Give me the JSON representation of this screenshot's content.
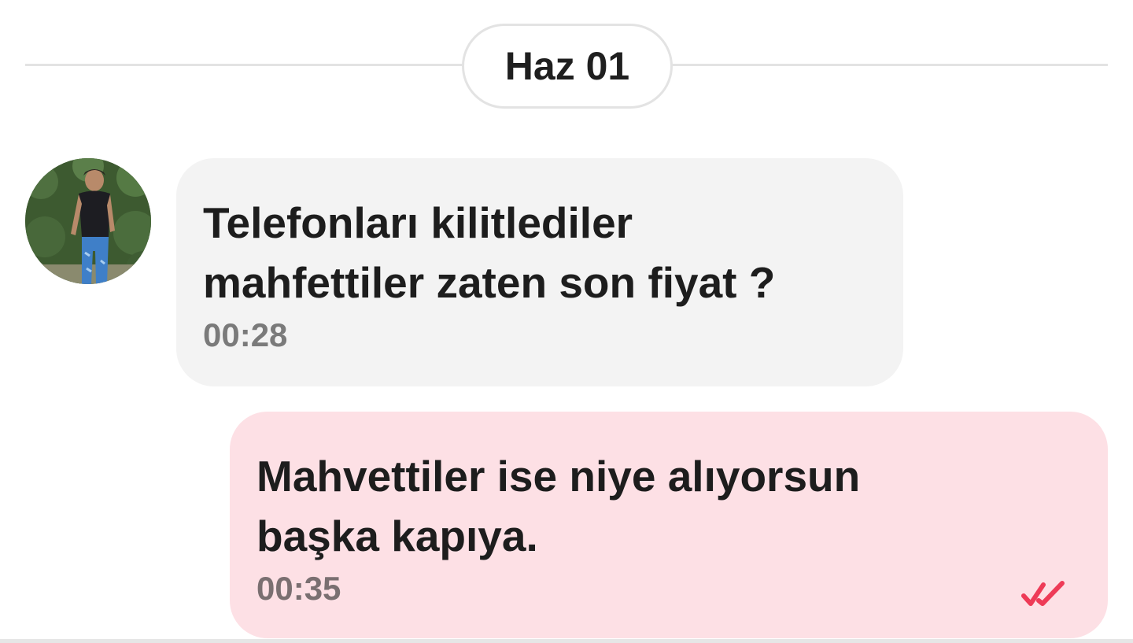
{
  "date_separator": {
    "label": "Haz 01"
  },
  "messages": [
    {
      "direction": "incoming",
      "text": "Telefonları kilitlediler\nmahfettiler zaten son fiyat ?",
      "time": "00:28",
      "avatar": "contact-avatar-photo"
    },
    {
      "direction": "outgoing",
      "text": "Mahvettiler ise niye alıyorsun\nbaşka kapıya.",
      "time": "00:35",
      "status_icon": "double-check-icon"
    }
  ],
  "colors": {
    "incoming_bubble": "#f3f3f3",
    "outgoing_bubble": "#fde0e5",
    "read_receipt": "#ee3b57",
    "separator": "#e3e3e3"
  }
}
